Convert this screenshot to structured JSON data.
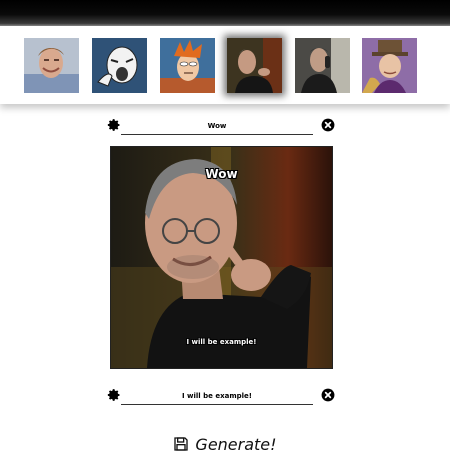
{
  "templates": [
    {
      "name": "Dawson crying",
      "selected": false
    },
    {
      "name": "Y U No",
      "selected": false
    },
    {
      "name": "Futurama Fry",
      "selected": false
    },
    {
      "name": "Steve Jobs",
      "selected": true
    },
    {
      "name": "Liam Neeson",
      "selected": false
    },
    {
      "name": "Condescending Wonka",
      "selected": false
    }
  ],
  "editor": {
    "top_caption": "Wow",
    "bottom_caption": "I will be example!",
    "preview_template": "Steve Jobs"
  },
  "icons": {
    "settings": "gear-icon",
    "remove": "close-circle-icon",
    "generate": "floppy-disk-icon"
  },
  "actions": {
    "generate_label": "Generate!"
  },
  "colors": {
    "topbar": "#000000",
    "text": "#111111",
    "caption_text": "#ffffff"
  }
}
